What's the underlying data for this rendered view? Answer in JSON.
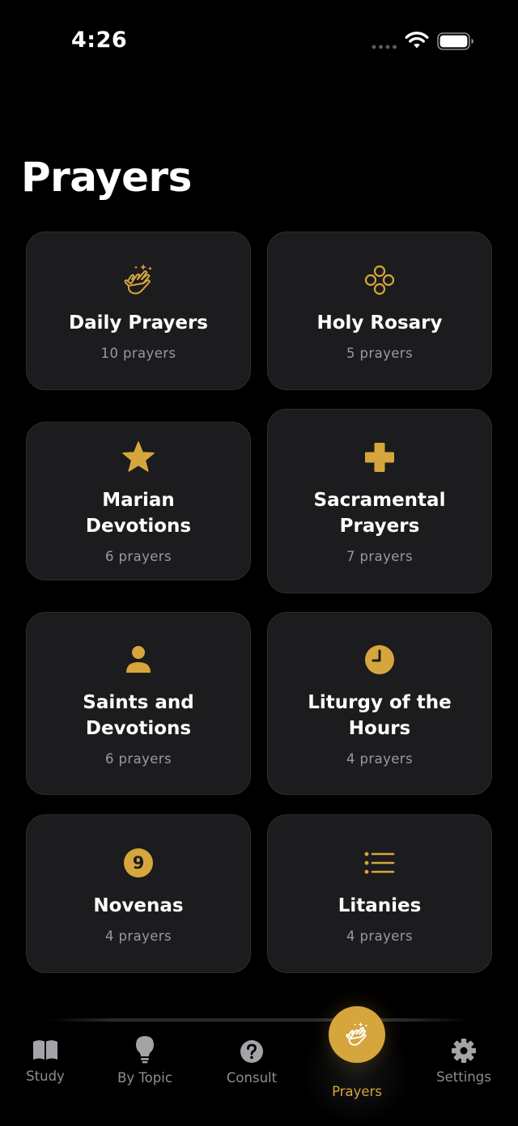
{
  "status_bar": {
    "time": "4:26"
  },
  "page": {
    "title": "Prayers"
  },
  "accent_color": "#d6a63c",
  "categories": [
    {
      "title": "Daily Prayers",
      "count": "10 prayers",
      "icon": "praying-hands-icon"
    },
    {
      "title": "Holy Rosary",
      "count": "5 prayers",
      "icon": "rosary-beads-icon"
    },
    {
      "title": "Marian Devotions",
      "count": "6 prayers",
      "icon": "star-icon"
    },
    {
      "title": "Sacramental Prayers",
      "count": "7 prayers",
      "icon": "cross-icon"
    },
    {
      "title": "Saints and Devotions",
      "count": "6 prayers",
      "icon": "person-icon"
    },
    {
      "title": "Liturgy of the Hours",
      "count": "4 prayers",
      "icon": "clock-icon"
    },
    {
      "title": "Novenas",
      "count": "4 prayers",
      "icon": "number-nine-icon"
    },
    {
      "title": "Litanies",
      "count": "4 prayers",
      "icon": "list-icon"
    }
  ],
  "tab_bar": {
    "items": [
      {
        "label": "Study",
        "icon": "book-icon"
      },
      {
        "label": "By Topic",
        "icon": "lightbulb-icon"
      },
      {
        "label": "Consult",
        "icon": "question-mark-icon"
      },
      {
        "label": "Prayers",
        "icon": "praying-hands-icon",
        "selected": true
      },
      {
        "label": "Settings",
        "icon": "gear-icon"
      }
    ]
  },
  "novena_number": "9"
}
